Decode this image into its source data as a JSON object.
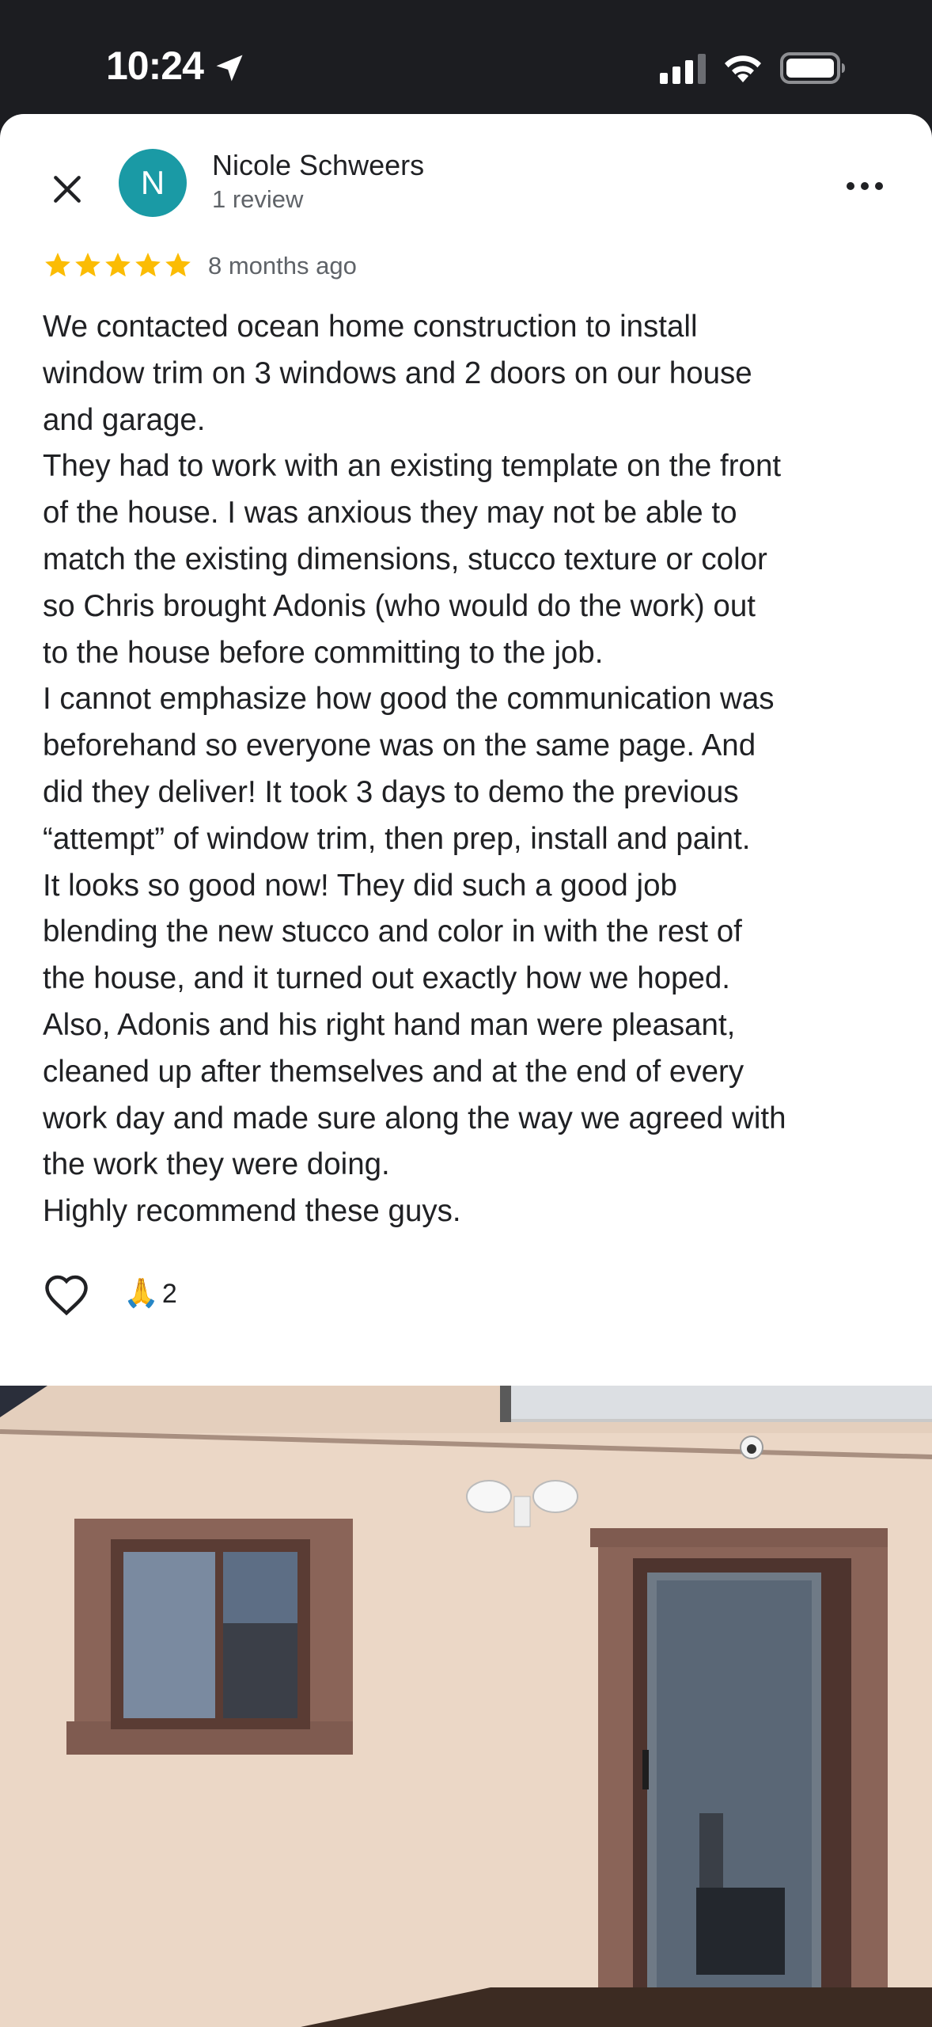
{
  "status_bar": {
    "time": "10:24",
    "icons": [
      "location-arrow-icon",
      "cellular-signal-icon",
      "wifi-icon",
      "battery-icon"
    ]
  },
  "review": {
    "reviewer_initial": "N",
    "reviewer_name": "Nicole Schweers",
    "review_count": "1 review",
    "rating": 5,
    "time_ago": "8 months ago",
    "text": "We contacted ocean home construction to install\nwindow trim on 3 windows and 2 doors on our house\nand garage.\nThey had to work with an existing template on the front\nof the house. I was anxious they may not be able to\nmatch the existing dimensions, stucco texture or color\nso Chris brought Adonis (who would do the work) out\nto the house before committing to the job.\nI cannot emphasize how good the communication was\nbeforehand so everyone was on the same page. And\ndid they deliver! It took 3 days to demo the previous\n“attempt” of window trim, then prep, install and paint.\nIt looks so good now! They did such a good job\nblending the new stucco and color in with the rest of\nthe house, and it turned out exactly how we hoped.\nAlso, Adonis and his right hand man were pleasant,\ncleaned up after themselves and at the end of every\nwork day and made sure along the way we agreed with\nthe work they were doing.\nHighly recommend these guys.",
    "reaction_emoji": "🙏",
    "reaction_count": "2"
  },
  "colors": {
    "status_bar_bg": "#1c1d21",
    "avatar_bg": "#1a9aa5",
    "star": "#fbbc04",
    "text_primary": "#202124",
    "text_secondary": "#5f6368"
  },
  "photo": {
    "description_icon": "review-photo"
  }
}
